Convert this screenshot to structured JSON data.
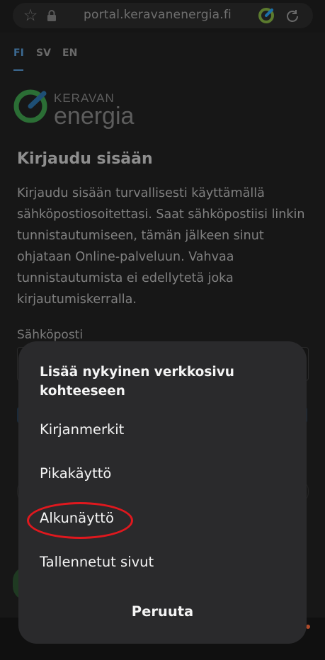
{
  "browser": {
    "url": "portal.keravanenergia.fi",
    "icons": [
      "star-icon",
      "lock-icon",
      "extension-icon",
      "reload-icon"
    ]
  },
  "page": {
    "languages": [
      "FI",
      "SV",
      "EN"
    ],
    "active_language": "FI",
    "logo": {
      "line1": "KERAVAN",
      "line2": "energia"
    },
    "heading": "Kirjaudu sisään",
    "description": "Kirjaudu sisään turvallisesti käyttämällä sähköpostiosoitettasi. Saat sähköpostiisi linkin tunnistautumiseen, tämän jälkeen sinut ohjataan Online-palveluun. Vahvaa tunnistautumista ei edellytetä joka kirjautumiskerralla.",
    "email_label": "Sähköposti"
  },
  "sheet": {
    "title": "Lisää nykyinen verkkosivu kohteeseen",
    "options": [
      "Kirjanmerkit",
      "Pikakäyttö",
      "Alkunäyttö",
      "Tallennetut sivut"
    ],
    "highlighted_option": "Alkunäyttö",
    "cancel_label": "Peruuta"
  },
  "colors": {
    "accent_blue": "#3c6a92",
    "logo_green": "#2e8b3a",
    "highlight_red": "#e0181e",
    "sheet_background": "#2a2a2c"
  }
}
